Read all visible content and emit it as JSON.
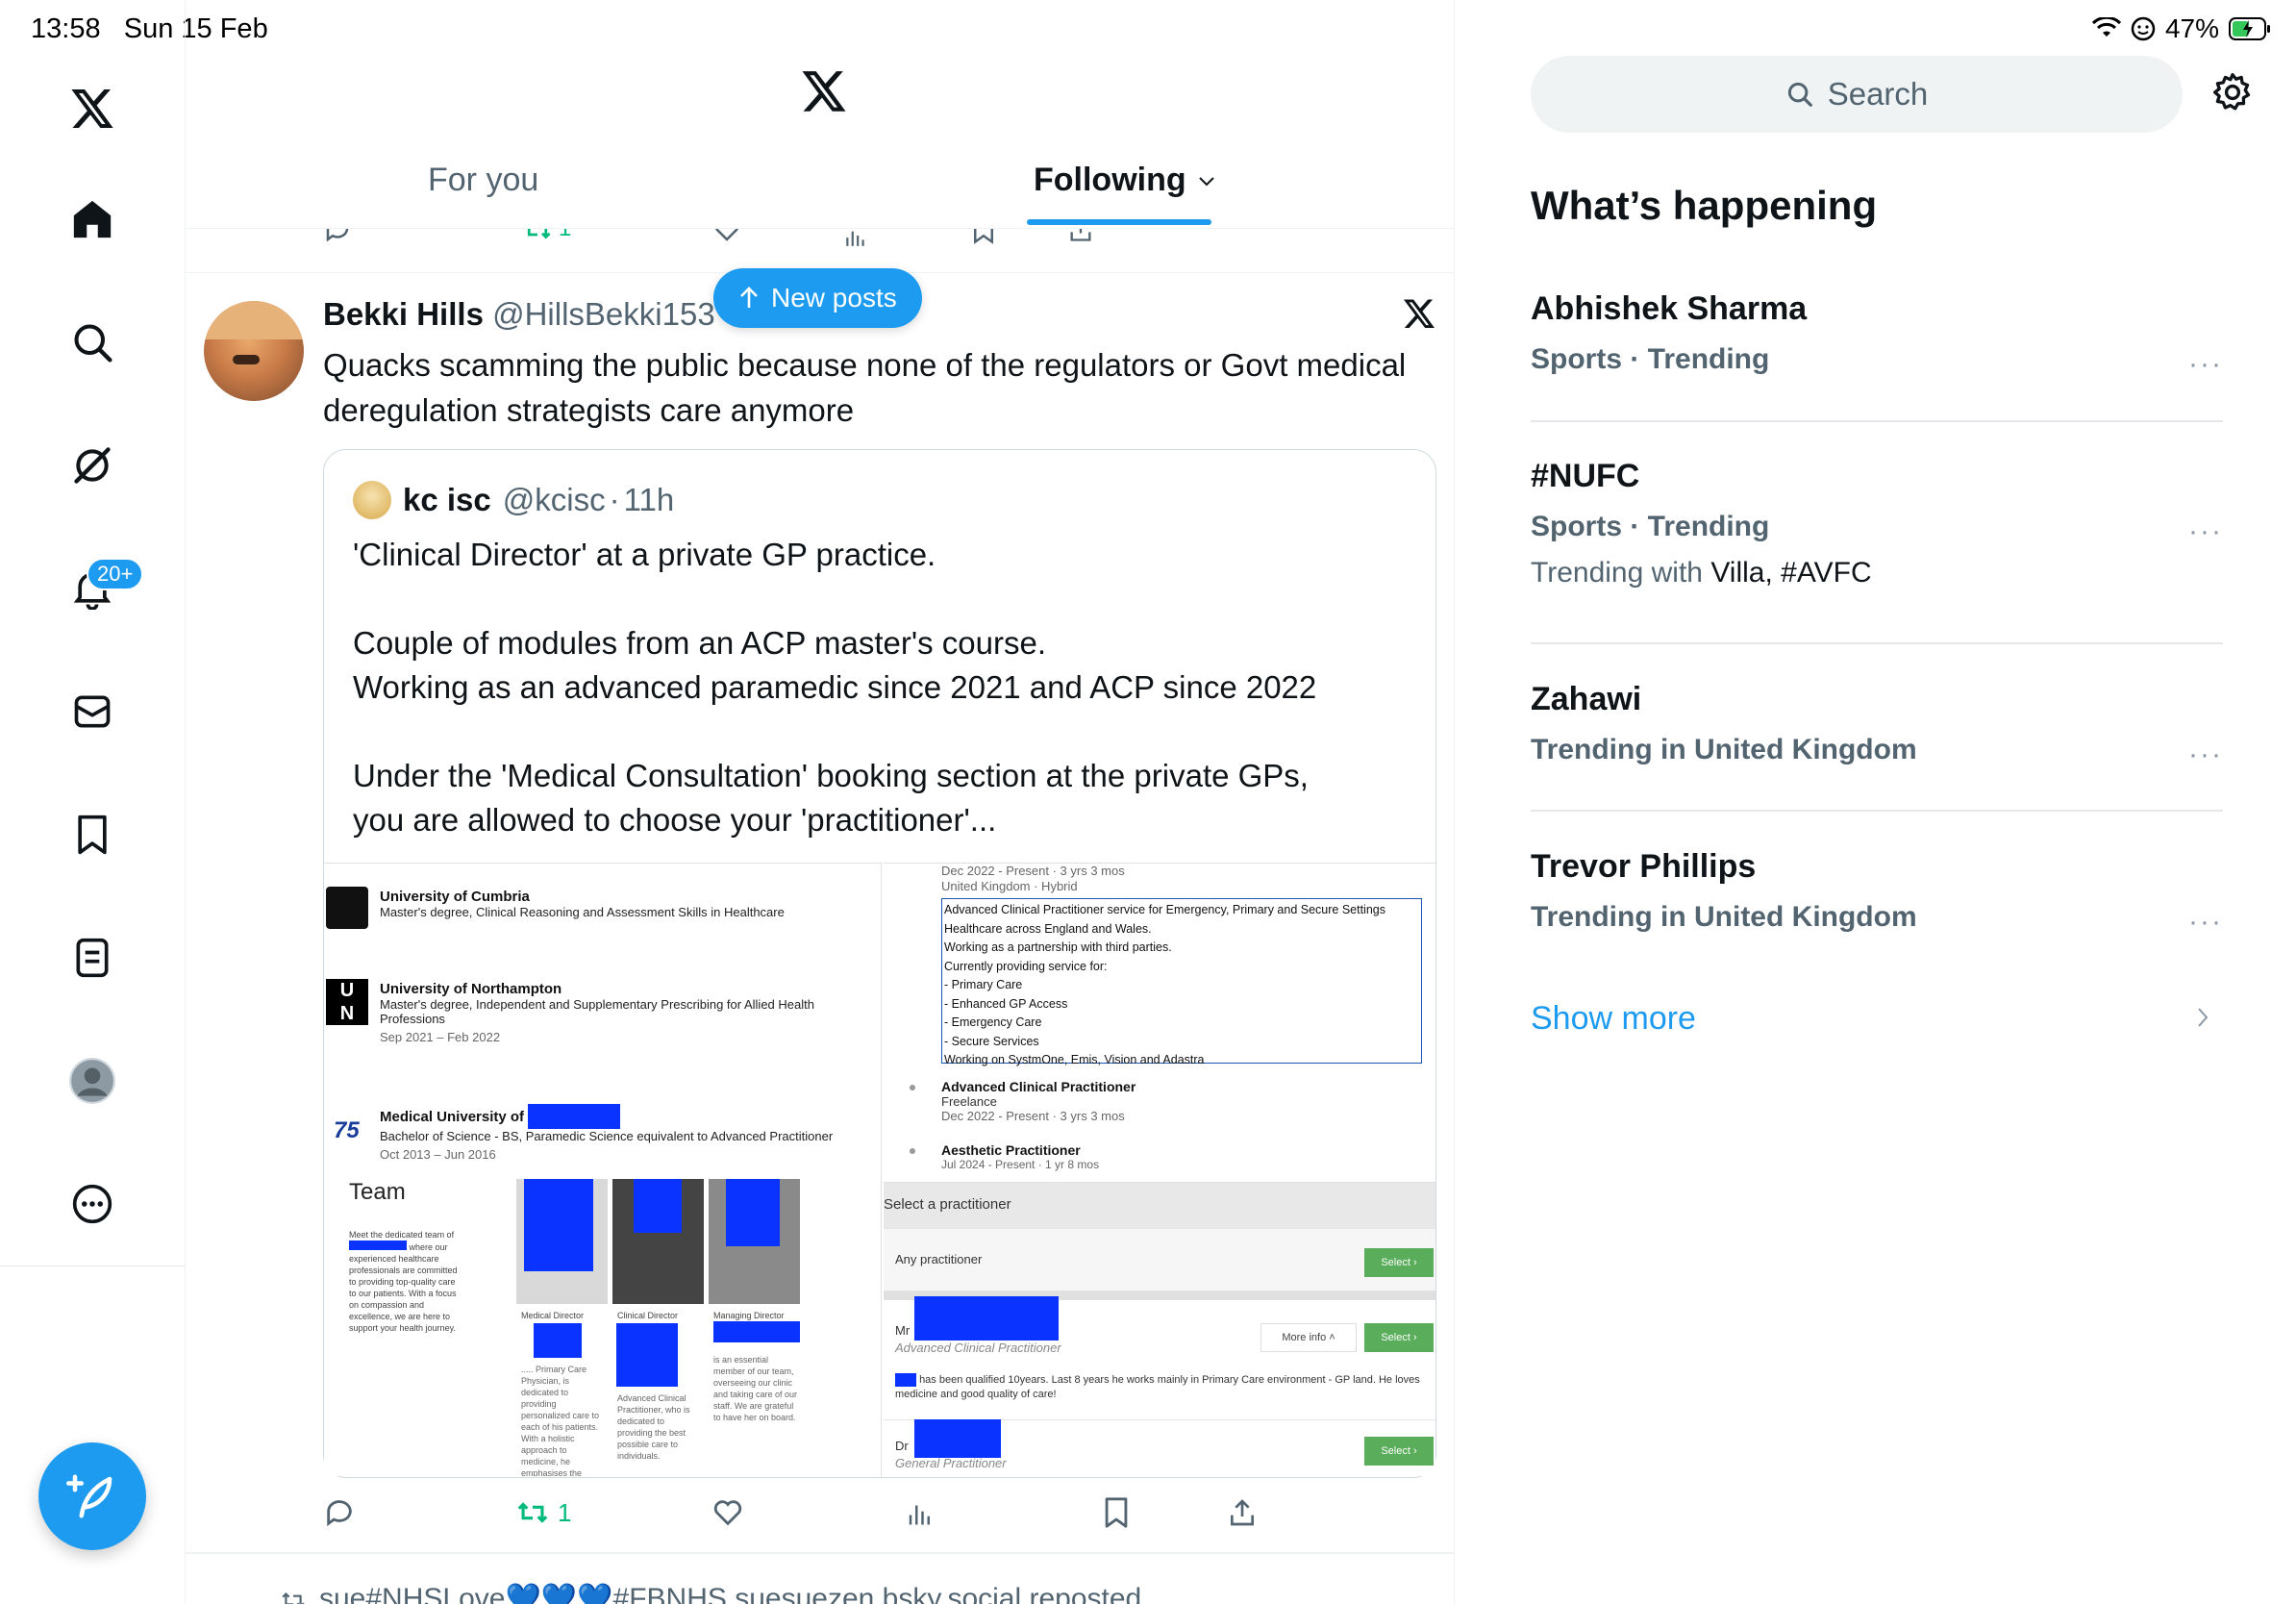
{
  "status_bar": {
    "time": "13:58",
    "date": "Sun 15 Feb",
    "battery": "47%"
  },
  "nav": {
    "notification_badge": "20+",
    "icons": [
      "x-logo-icon",
      "home-icon",
      "search-icon",
      "grok-icon",
      "notifications-icon",
      "messages-icon",
      "bookmarks-icon",
      "lists-icon",
      "profile-icon",
      "more-icon"
    ]
  },
  "tabs": {
    "for_you": "For you",
    "following": "Following"
  },
  "new_posts": "New posts",
  "prev_row": {
    "repost_count": "1"
  },
  "post": {
    "name": "Bekki Hills",
    "handle": "@HillsBekki153",
    "text": "Quacks scamming the public because none of the regulators or Govt medical deregulation strategists care anymore",
    "repost_count": "1",
    "quote": {
      "name": "kc isc",
      "handle": "@kcisc",
      "time": "11h",
      "text": "'Clinical Director' at a private GP practice.\n\nCouple of modules from an ACP master's course.\nWorking as an advanced paramedic since 2021 and ACP since 2022\n\nUnder the 'Medical Consultation' booking section at the private GPs,\nyou are allowed to choose your 'practitioner'...",
      "image1": {
        "edu": [
          {
            "name": "University of Cumbria",
            "sub": "Master's degree, Clinical Reasoning and Assessment Skills in Healthcare",
            "date": ""
          },
          {
            "name": "University of Northampton",
            "sub": "Master's degree, Independent and Supplementary Prescribing for Allied Health Professions",
            "date": "Sep 2021 – Feb 2022"
          },
          {
            "name": "Medical University of",
            "sub": "Bachelor of Science - BS, Paramedic Science equivalent to Advanced Practitioner",
            "date": "Oct 2013 – Jun 2016"
          }
        ],
        "team_title": "Team",
        "team_roles": [
          "Medical Director",
          "Clinical Director",
          "Managing Director"
        ]
      },
      "image2": {
        "date1": "Dec 2022 - Present · 3 yrs 3 mos",
        "loc": "United Kingdom · Hybrid",
        "box_lines": [
          "Advanced Clinical Practitioner service for Emergency, Primary and Secure Settings",
          "Healthcare across England and Wales.",
          "Working as a partnership with third parties.",
          "Currently providing service for:",
          "- Primary Care",
          "- Enhanced GP Access",
          "- Emergency Care",
          "- Secure Services",
          "Working on SystmOne, Emis, Vision and Adastra"
        ],
        "role1": "Advanced Clinical Practitioner",
        "role1_type": "Freelance",
        "role1_date": "Dec 2022 - Present · 3 yrs 3 mos",
        "role2": "Aesthetic Practitioner",
        "role2_date": "Jul 2024 - Present · 1 yr 8 mos"
      },
      "image3": {
        "header": "Select a practitioner",
        "any": "Any practitioner",
        "select": "Select",
        "more_info": "More info",
        "mr_prefix": "Mr",
        "acp_label": "Advanced Clinical Practitioner",
        "bio": "has been qualified 10years. Last 8 years he works mainly in Primary Care environment - GP land. He loves medicine and good quality of care!",
        "dr_prefix": "Dr",
        "gp_label": "General Practitioner"
      }
    }
  },
  "next_row_repost": "sue#NHSLove💙💙💙#FBNHS suesuezen.bsky.social reposted",
  "right": {
    "search_placeholder": "Search",
    "title": "What’s happening",
    "trends": [
      {
        "name": "Abhishek Sharma",
        "meta": "Sports · Trending",
        "extra_prefix": "",
        "extra_tags": ""
      },
      {
        "name": "#NUFC",
        "meta": "Sports · Trending",
        "extra_prefix": "Trending with",
        "extra_tags": "Villa, #AVFC"
      },
      {
        "name": "Zahawi",
        "meta": "Trending in United Kingdom",
        "extra_prefix": "",
        "extra_tags": ""
      },
      {
        "name": "Trevor Phillips",
        "meta": "Trending in United Kingdom",
        "extra_prefix": "",
        "extra_tags": ""
      }
    ],
    "more_glyph": "···",
    "show_more": "Show more"
  },
  "colors": {
    "accent": "#1d9bf0",
    "repost_green": "#00ba7c",
    "text_primary": "#0f1419",
    "text_secondary": "#536471"
  }
}
